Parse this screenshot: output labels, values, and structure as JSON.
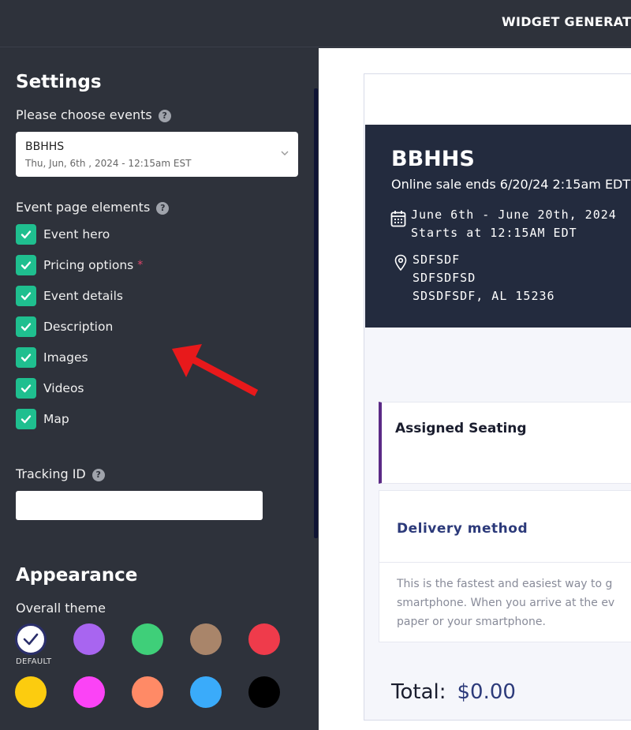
{
  "topbar": {
    "title": "WIDGET GENERATO"
  },
  "sidebar": {
    "settings_heading": "Settings",
    "choose_events_label": "Please choose events",
    "help_glyph": "?",
    "event_select": {
      "name": "BBHHS",
      "date": "Thu, Jun, 6th , 2024 - 12:15am EST"
    },
    "elements_label": "Event page elements",
    "elements": [
      {
        "label": "Event hero",
        "checked": true,
        "required": false
      },
      {
        "label": "Pricing options",
        "checked": true,
        "required": true
      },
      {
        "label": "Event details",
        "checked": true,
        "required": false
      },
      {
        "label": "Description",
        "checked": true,
        "required": false
      },
      {
        "label": "Images",
        "checked": true,
        "required": false
      },
      {
        "label": "Videos",
        "checked": true,
        "required": false
      },
      {
        "label": "Map",
        "checked": true,
        "required": false
      }
    ],
    "required_mark": "*",
    "tracking_label": "Tracking ID",
    "tracking_value": "",
    "appearance_heading": "Appearance",
    "theme_label": "Overall theme",
    "default_label": "DEFAULT",
    "themes": [
      "#ffffff",
      "#a865f0",
      "#3fcf79",
      "#a9856a",
      "#ef3b4b",
      "#fccc0f",
      "#fb43f6",
      "#ff8a66",
      "#3aabfa",
      "#000000"
    ],
    "selected_theme_index": 0
  },
  "preview": {
    "event_title": "BBHHS",
    "sale_text": "Online sale ends 6/20/24 2:15am EDT",
    "date_range": "June 6th - June 20th, 2024",
    "start_time": "Starts at 12:15AM EDT",
    "address_line1": "SDFSDF",
    "address_line2": "SDFSDFSD",
    "address_line3": "SDSDFSDF, AL 15236",
    "assigned_seating": "Assigned Seating",
    "delivery_method": "Delivery method",
    "delivery_desc": [
      "This is the fastest and easiest way to g",
      "smartphone. When you arrive at the ev",
      "paper or your smartphone."
    ],
    "total_label": "Total:",
    "total_value": "$0.00"
  },
  "colors": {
    "sidebar_bg": "#2e323b",
    "checkbox": "#1fbf8f",
    "hero_bg": "#232b3e",
    "accent_purple": "#5b2a86",
    "arrow": "#e8191b"
  }
}
